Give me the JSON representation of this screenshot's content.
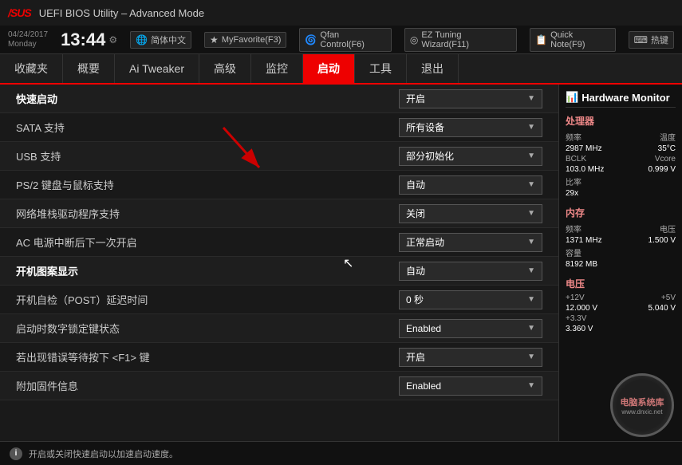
{
  "titlebar": {
    "logo": "/sus",
    "title": "UEFI BIOS Utility – Advanced Mode"
  },
  "infobar": {
    "date": "04/24/2017",
    "day": "Monday",
    "time": "13:44",
    "gear": "⚙",
    "buttons": [
      {
        "id": "lang",
        "icon": "🌐",
        "label": "简体中文"
      },
      {
        "id": "myfav",
        "icon": "★",
        "label": "MyFavorite(F3)"
      },
      {
        "id": "qfan",
        "icon": "🌀",
        "label": "Qfan Control(F6)"
      },
      {
        "id": "eztuning",
        "icon": "◎",
        "label": "EZ Tuning Wizard(F11)"
      },
      {
        "id": "quicknote",
        "icon": "📋",
        "label": "Quick Note(F9)"
      },
      {
        "id": "hotkey",
        "icon": "⌨",
        "label": "热键"
      }
    ]
  },
  "navbar": {
    "items": [
      {
        "id": "collect",
        "label": "收藏夹",
        "active": false
      },
      {
        "id": "overview",
        "label": "概要",
        "active": false
      },
      {
        "id": "aitweaker",
        "label": "Ai Tweaker",
        "active": false
      },
      {
        "id": "advanced",
        "label": "高级",
        "active": false
      },
      {
        "id": "monitor",
        "label": "监控",
        "active": false
      },
      {
        "id": "boot",
        "label": "启动",
        "active": true
      },
      {
        "id": "tools",
        "label": "工具",
        "active": false
      },
      {
        "id": "exit",
        "label": "退出",
        "active": false
      }
    ]
  },
  "settings": {
    "rows": [
      {
        "label": "快速启动",
        "value": "开启",
        "bold": true
      },
      {
        "label": "SATA 支持",
        "value": "所有设备",
        "bold": false
      },
      {
        "label": "USB 支持",
        "value": "部分初始化",
        "bold": false
      },
      {
        "label": "PS/2 键盘与鼠标支持",
        "value": "自动",
        "bold": false
      },
      {
        "label": "网络堆栈驱动程序支持",
        "value": "关闭",
        "bold": false
      },
      {
        "label": "AC 电源中断后下一次开启",
        "value": "正常启动",
        "bold": false
      },
      {
        "label": "开机图案显示",
        "value": "自动",
        "bold": true
      },
      {
        "label": "开机自检（POST）延迟时间",
        "value": "0 秒",
        "bold": false
      },
      {
        "label": "启动时数字锁定键状态",
        "value": "Enabled",
        "bold": false
      },
      {
        "label": "若出现错误等待按下 <F1> 键",
        "value": "开启",
        "bold": false
      },
      {
        "label": "附加固件信息",
        "value": "Enabled",
        "bold": false
      }
    ]
  },
  "rightpanel": {
    "title": "Hardware Monitor",
    "icon": "📊",
    "sections": [
      {
        "name": "处理器",
        "rows": [
          {
            "label1": "频率",
            "value1": "2987 MHz",
            "label2": "温度",
            "value2": "35°C"
          },
          {
            "label1": "BCLK",
            "value1": "103.0 MHz",
            "label2": "Vcore",
            "value2": "0.999 V"
          },
          {
            "label1": "比率",
            "value1": "29x",
            "label2": "",
            "value2": ""
          }
        ]
      },
      {
        "name": "内存",
        "rows": [
          {
            "label1": "频率",
            "value1": "1371 MHz",
            "label2": "电压",
            "value2": "1.500 V"
          },
          {
            "label1": "容量",
            "value1": "8192 MB",
            "label2": "",
            "value2": ""
          }
        ]
      },
      {
        "name": "电压",
        "rows": [
          {
            "label1": "+12V",
            "value1": "12.000 V",
            "label2": "+5V",
            "value2": "5.040 V"
          },
          {
            "label1": "+3.3V",
            "value1": "3.360 V",
            "label2": "",
            "value2": ""
          }
        ]
      }
    ]
  },
  "bottombar": {
    "icon": "i",
    "text": "开启或关闭快速启动以加速启动速度。"
  }
}
